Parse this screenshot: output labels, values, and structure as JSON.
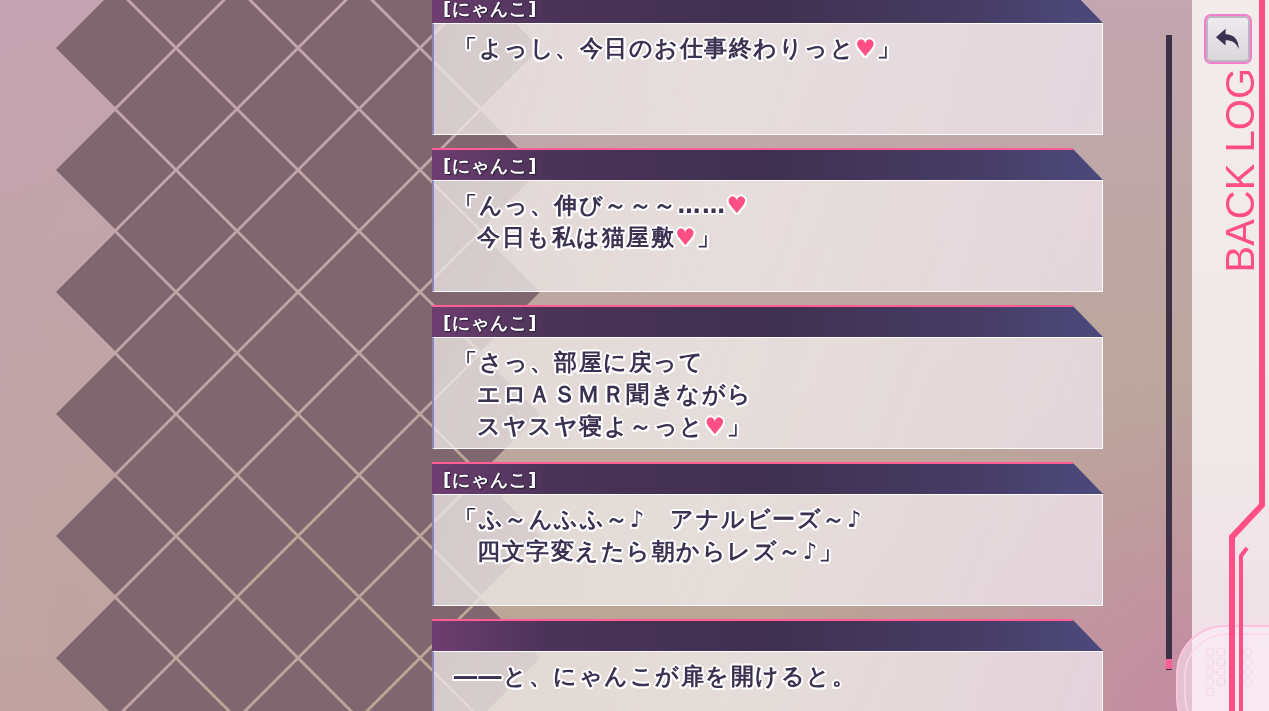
{
  "backlog": {
    "title": "BACK LOG",
    "entries": [
      {
        "speaker": "[にゃんこ]",
        "lines": [
          [
            {
              "kind": "text",
              "text": "「よっし、今日のお仕事終わりっと"
            },
            {
              "kind": "heart",
              "text": "♥"
            },
            {
              "kind": "text",
              "text": "」"
            }
          ]
        ]
      },
      {
        "speaker": "[にゃんこ]",
        "lines": [
          [
            {
              "kind": "text",
              "text": "「んっ、伸び～～～……"
            },
            {
              "kind": "heart",
              "text": "♥"
            }
          ],
          [
            {
              "kind": "text",
              "text": "今日も私は猫屋敷"
            },
            {
              "kind": "heart",
              "text": "♥"
            },
            {
              "kind": "text",
              "text": "」"
            }
          ]
        ]
      },
      {
        "speaker": "[にゃんこ]",
        "lines": [
          [
            {
              "kind": "text",
              "text": "「さっ、部屋に戻って"
            }
          ],
          [
            {
              "kind": "text",
              "text": "エロＡＳＭＲ聞きながら"
            }
          ],
          [
            {
              "kind": "text",
              "text": "スヤスヤ寝よ～っと"
            },
            {
              "kind": "heart",
              "text": "♥"
            },
            {
              "kind": "text",
              "text": "」"
            }
          ]
        ]
      },
      {
        "speaker": "[にゃんこ]",
        "lines": [
          [
            {
              "kind": "text",
              "text": "「ふ～んふふ～♪　アナルビーズ～♪"
            }
          ],
          [
            {
              "kind": "text",
              "text": "四文字変えたら朝からレズ～♪」"
            }
          ]
        ]
      },
      {
        "lines": [
          [
            {
              "kind": "text",
              "text": "――と、にゃんこが扉を開けると。"
            }
          ]
        ]
      }
    ]
  }
}
